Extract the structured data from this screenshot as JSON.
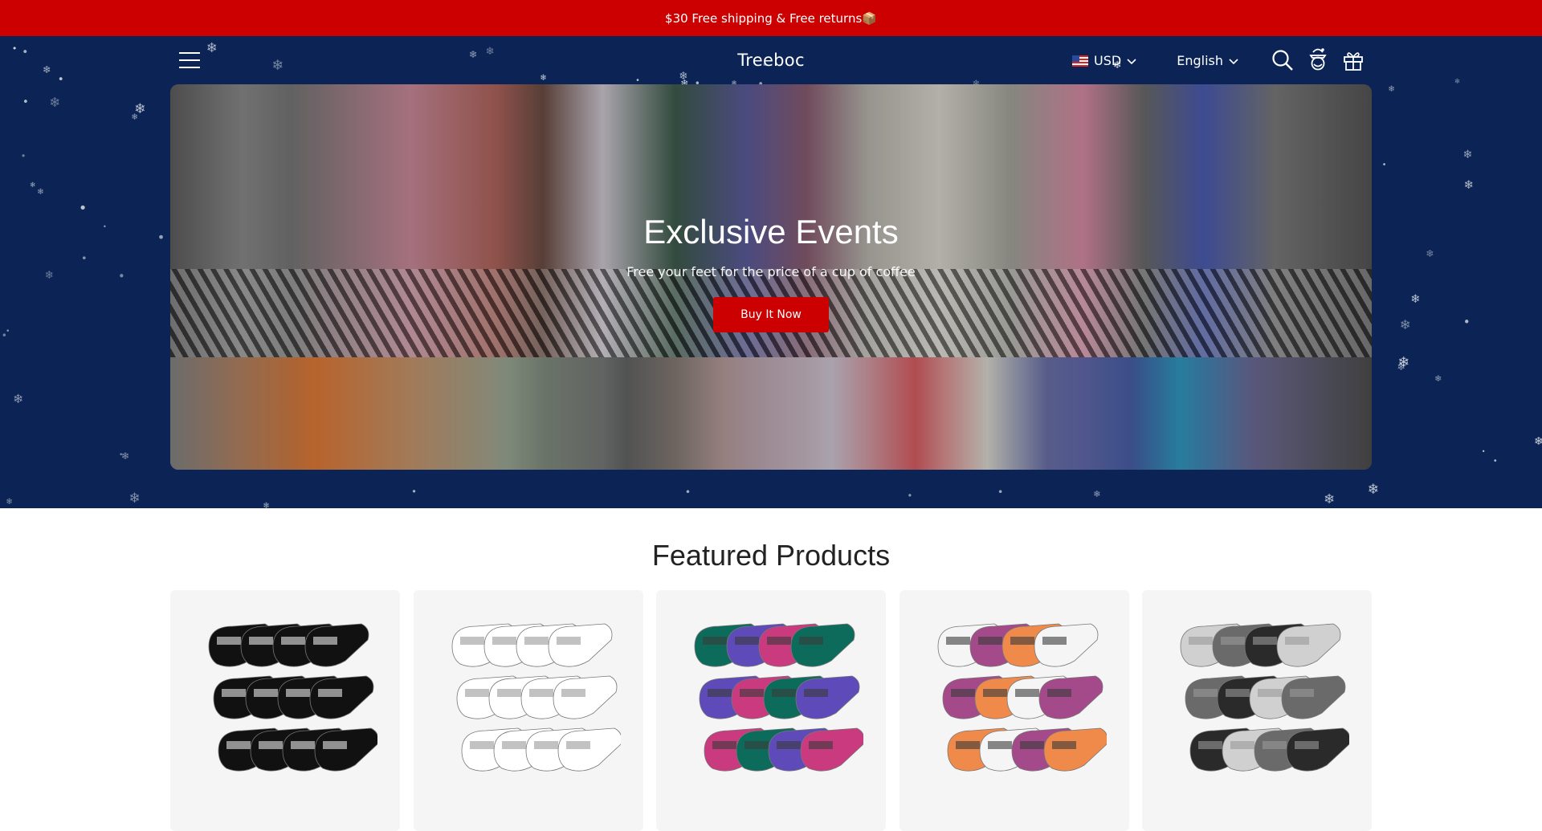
{
  "announcement": {
    "text": "$30 Free shipping & Free returns📦"
  },
  "header": {
    "brand": "Treeboc",
    "currency": {
      "label": "USD",
      "flag": "us-flag-icon"
    },
    "language": {
      "label": "English"
    },
    "icons": [
      "menu-icon",
      "search-icon",
      "account-icon",
      "gift-icon"
    ]
  },
  "hero": {
    "title": "Exclusive Events",
    "subtitle": "Free your feet for the price of a cup of coffee",
    "cta_label": "Buy It Now"
  },
  "featured": {
    "title": "Featured Products",
    "products": [
      {
        "name": "black-ankle-socks-pack",
        "palette": [
          "#111111",
          "#111111",
          "#111111"
        ],
        "accent": "#e8e8e8"
      },
      {
        "name": "white-ankle-socks-pack",
        "palette": [
          "#ffffff",
          "#ffffff",
          "#ffffff"
        ],
        "accent": "#9a9a9a"
      },
      {
        "name": "colorful-ankle-socks-pack",
        "palette": [
          "#0d6b5c",
          "#5e4ab8",
          "#c93a7e"
        ],
        "accent": "#3a3a3a"
      },
      {
        "name": "mixed-color-ankle-socks-pack",
        "palette": [
          "#f5f5f5",
          "#a44a8a",
          "#f08a4a"
        ],
        "accent": "#3a3a3a"
      },
      {
        "name": "grey-ankle-socks-pack",
        "palette": [
          "#d0d0d0",
          "#6a6a6a",
          "#2a2a2a"
        ],
        "accent": "#9a9a9a"
      }
    ]
  },
  "colors": {
    "announce_bg": "#cc0000",
    "navy": "#0b2455",
    "cta": "#cc0000"
  }
}
